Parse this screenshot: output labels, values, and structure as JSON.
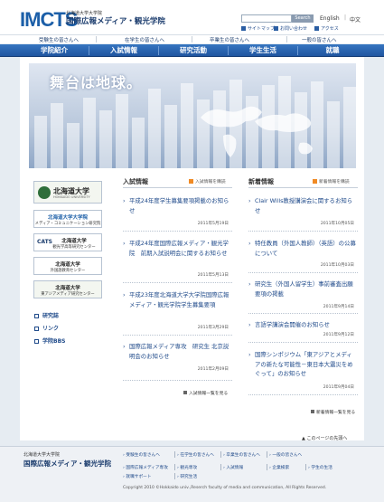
{
  "header": {
    "logo_mark": "IMCTS",
    "logo_sub": "北海道大学大学院",
    "logo_name": "国際広報メディア・観光学院",
    "search_button": "Search",
    "lang_en": "English",
    "lang_sep": "|",
    "lang_zh": "中文",
    "util_links": [
      "サイトマップ",
      "お問い合わせ",
      "アクセス"
    ]
  },
  "audience_links": [
    "受験生の皆さんへ",
    "在学生の皆さんへ",
    "卒業生の皆さんへ",
    "一般の皆さんへ"
  ],
  "main_nav": [
    "学院紹介",
    "入試情報",
    "研究活動",
    "学生生活",
    "就職"
  ],
  "hero": {
    "title": "舞台は地球。"
  },
  "sidebar": {
    "banners": [
      {
        "title": "北海道大学",
        "sub": "HOKKAIDO UNIVERSITY"
      },
      {
        "title": "北海道大学大学院",
        "sub": "メディア・コミュニケーション研究院"
      },
      {
        "title": "北海道大学",
        "sub": "観光学高等研究センター",
        "badge": "CATS"
      },
      {
        "title": "北海道大学",
        "sub": "外国語教育センター"
      },
      {
        "title": "北海道大学",
        "sub": "東アジアメディア研究センター"
      }
    ],
    "links": [
      "研究誌",
      "リンク",
      "学院BBS"
    ]
  },
  "admissions": {
    "title": "入試情報",
    "rss": "入試情報を購読",
    "items": [
      {
        "text": "平成24年度学生募集要項掲載のお知らせ",
        "date": "2011年5月19日"
      },
      {
        "text": "平成24年度国際広報メディア・観光学院　前期入試説明会に関するお知らせ",
        "date": "2011年5月13日"
      },
      {
        "text": "平成23年度北海道大学大学院国際広報メディア・観光学院学生募集要項",
        "date": "2011年3月29日"
      },
      {
        "text": "国際広報メディア専攻　研究生 北京説明会のお知らせ",
        "date": "2011年2月09日"
      }
    ],
    "more": "入試情報一覧を見る"
  },
  "news": {
    "title": "新着情報",
    "rss": "新着情報を購読",
    "items": [
      {
        "text": "Clair Wills教授講演会に関するお知らせ",
        "date": "2011年10月05日"
      },
      {
        "text": "特任教員（外国人教師）（英語）の公募について",
        "date": "2011年10月03日"
      },
      {
        "text": "研究生（外国人留学生）事前審査出願要項の掲載",
        "date": "2011年9月14日"
      },
      {
        "text": "言語学講演会開催のお知らせ",
        "date": "2011年9月12日"
      },
      {
        "text": "国際シンポジウム「東アジアとメディアの新たな可能性－東日本大震災をめぐって」のお知らせ",
        "date": "2011年9月04日"
      }
    ],
    "more": "新着情報一覧を見る"
  },
  "page_top": "このページの先頭へ",
  "footer": {
    "sub": "北海道大学大学院",
    "name": "国際広報メディア・観光学院",
    "links_row1": [
      "受験生の皆さんへ",
      "在学生の皆さんへ",
      "卒業生の皆さんへ",
      "一般の皆さんへ"
    ],
    "links_row2": [
      "国際広報メディア専攻",
      "観光専攻",
      "入試情報",
      "企業検索",
      "学生の生活"
    ],
    "links_row3": [
      "就職サポート",
      "研究生活"
    ],
    "copyright": "Copyright 2010 ©Hokkaido univ.,Reserch faculty of media and communication, All Rights Reserved."
  },
  "colors": {
    "brand_blue": "#1c5fa8",
    "nav_blue": "#2a64b0",
    "link_blue": "#1f4a8a",
    "rss_orange": "#f08a24"
  }
}
